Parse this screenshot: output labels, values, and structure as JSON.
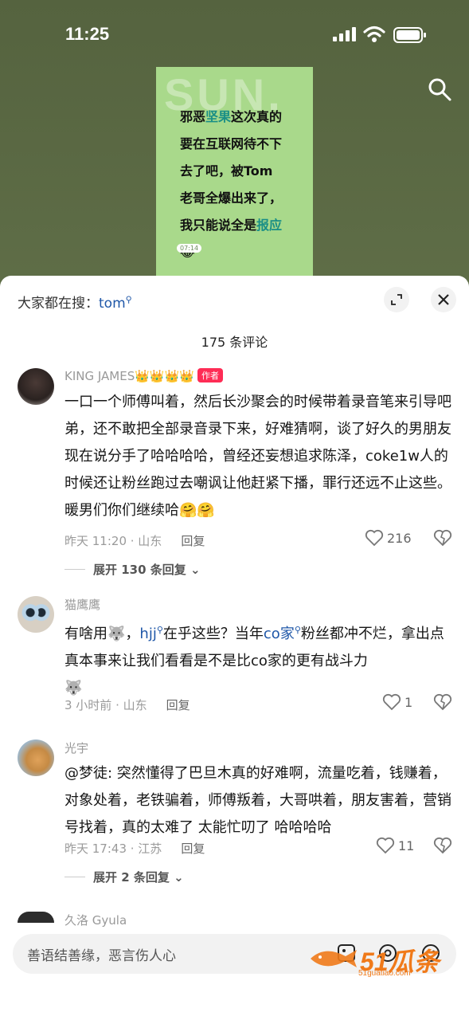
{
  "status": {
    "time": "11:25"
  },
  "video": {
    "watermark": "SUN.",
    "lines": [
      "邪恶",
      "坚果",
      "这次真的",
      "要在互联网待不下",
      "去了吧，被Tom",
      "老哥全爆出来了，",
      "我只能说全是",
      "报应"
    ],
    "emoji": "😂",
    "timestamp": "07:14"
  },
  "comments_panel": {
    "hot_search_prefix": "大家都在搜：",
    "hot_search_keyword": "tom",
    "count_text": "175 条评论",
    "input_placeholder": "善语结善缘，恶言伤人心"
  },
  "comments": [
    {
      "user": "KING JAMES",
      "crowns": "👑👑👑👑",
      "author_tag": "作者",
      "text": "一口一个师傅叫着，然后长沙聚会的时候带着录音笔来引导吧弟，还不敢把全部录音录下来，好难猜啊，谈了好久的男朋友现在说分手了哈哈哈哈，曾经还妄想追求陈泽，coke1w人的时候还让粉丝跑过去嘲讽让他赶紧下播，罪行还远不止这些。暖男们你们继续哈🤗🤗",
      "time_loc": "昨天 11:20 · 山东",
      "reply": "回复",
      "likes": "216",
      "expand": "展开 130 条回复"
    },
    {
      "user": "猫鹰鹰",
      "text_a": "有啥用",
      "text_b": "，",
      "mention": "hjj",
      "text_c": "在乎这些？当年",
      "mention2": "co家",
      "text_d": "粉丝都冲不烂，拿出点真本事来让我们看看是不是比co家的更有战斗力",
      "time_loc": "3 小时前 · 山东",
      "reply": "回复",
      "likes": "1"
    },
    {
      "user": "光宇",
      "text": "@梦徒: 突然懂得了巴旦木真的好难啊，流量吃着，钱赚着，对象处着，老铁骗着，师傅叛着，大哥哄着，朋友害着，营销号找着，真的太难了 太能忙叨了 哈哈哈哈",
      "time_loc": "昨天 17:43 · 江苏",
      "reply": "回复",
      "likes": "11",
      "expand": "展开 2 条回复"
    },
    {
      "user": "久洛 Gyula"
    }
  ],
  "brand": {
    "main": "51瓜条",
    "url": "51guatiao.com"
  },
  "icons": [
    "search-icon",
    "expand-icon",
    "close-icon",
    "heart-icon",
    "broken-heart-icon",
    "chevron-down-icon",
    "image-icon",
    "at-icon",
    "emoji-icon"
  ]
}
